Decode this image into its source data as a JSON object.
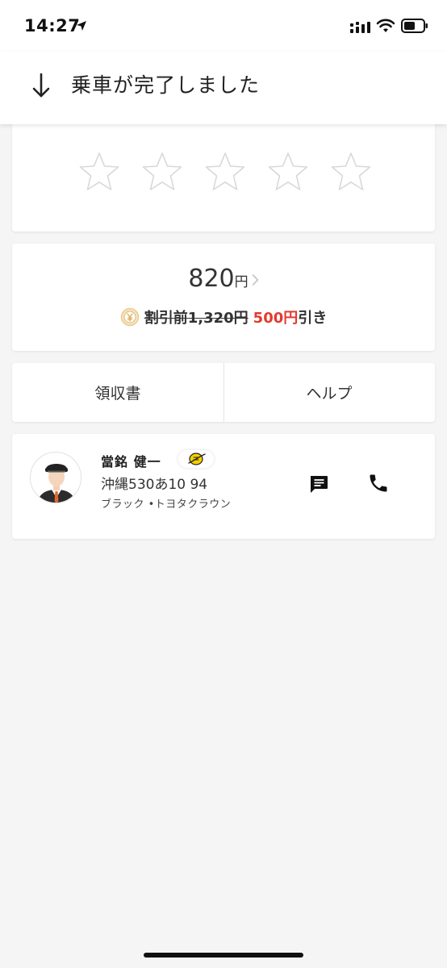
{
  "status_bar": {
    "time": "14:27"
  },
  "header": {
    "title": "乗車が完了しました"
  },
  "rating": {
    "max_stars": 5,
    "selected": 0
  },
  "fare": {
    "amount": "820",
    "unit": "円",
    "original_price": "割引前1,320円",
    "discount_amount": "500円",
    "discount_suffix": "引き"
  },
  "actions": {
    "receipt_label": "領収書",
    "help_label": "ヘルプ"
  },
  "driver": {
    "name": "當銘 健一",
    "plate": "沖縄530あ10 94",
    "vehicle": "ブラック •トヨタクラウン"
  },
  "colors": {
    "discount_red": "#e23b2e",
    "star_outline": "#d8d8d8",
    "badge_yellow": "#f5d000"
  }
}
